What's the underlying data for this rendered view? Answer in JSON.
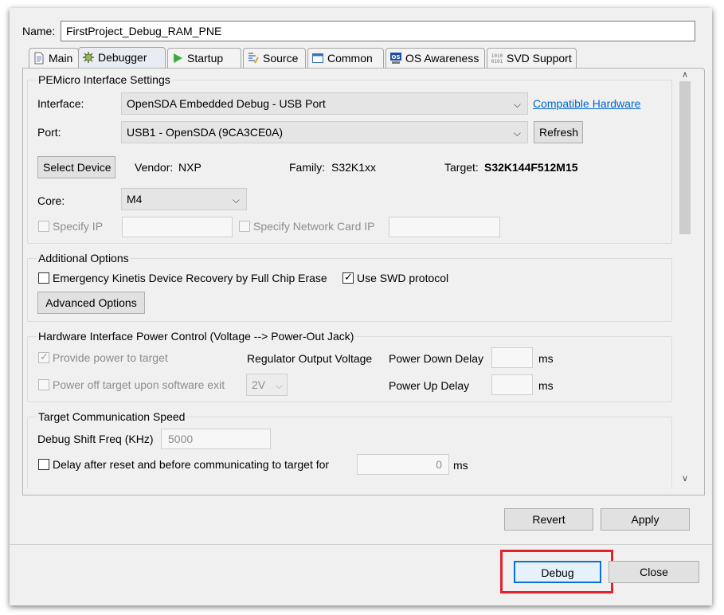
{
  "name": {
    "label": "Name:",
    "value": "FirstProject_Debug_RAM_PNE"
  },
  "tabs": [
    {
      "label": "Main",
      "icon": "document-icon"
    },
    {
      "label": "Debugger",
      "icon": "bug-gear-icon",
      "active": true
    },
    {
      "label": "Startup",
      "icon": "play-icon"
    },
    {
      "label": "Source",
      "icon": "source-icon"
    },
    {
      "label": "Common",
      "icon": "window-icon"
    },
    {
      "label": "OS Awareness",
      "icon": "os-icon"
    },
    {
      "label": "SVD Support",
      "icon": "binary-icon"
    }
  ],
  "pemicro": {
    "title": "PEMicro Interface Settings",
    "interface_label": "Interface:",
    "interface_value": "OpenSDA Embedded Debug - USB Port",
    "compatible_hardware": "Compatible Hardware",
    "port_label": "Port:",
    "port_value": "USB1 - OpenSDA (9CA3CE0A)",
    "refresh": "Refresh",
    "select_device": "Select Device",
    "vendor_label": "Vendor:",
    "vendor_value": "NXP",
    "family_label": "Family:",
    "family_value": "S32K1xx",
    "target_label": "Target:",
    "target_value": "S32K144F512M15",
    "core_label": "Core:",
    "core_value": "M4",
    "specify_ip": "Specify IP",
    "specify_network_card_ip": "Specify Network Card IP"
  },
  "additional": {
    "title": "Additional Options",
    "emergency_recovery": "Emergency Kinetis Device Recovery by Full Chip Erase",
    "use_swd": "Use SWD protocol",
    "advanced_options": "Advanced Options"
  },
  "power": {
    "title": "Hardware Interface Power Control (Voltage --> Power-Out Jack)",
    "provide_power": "Provide power to target",
    "power_off": "Power off target upon software exit",
    "regulator_label": "Regulator Output Voltage",
    "regulator_value": "2V",
    "power_down_label": "Power Down Delay",
    "power_down_unit": "ms",
    "power_up_label": "Power Up Delay",
    "power_up_unit": "ms"
  },
  "speed": {
    "title": "Target Communication Speed",
    "shift_freq_label": "Debug Shift Freq (KHz)",
    "shift_freq_value": "5000",
    "delay_label": "Delay after reset and before communicating to target for",
    "delay_value": "0",
    "delay_unit": "ms"
  },
  "buttons": {
    "revert": "Revert",
    "apply": "Apply",
    "debug": "Debug",
    "close": "Close"
  },
  "colors": {
    "highlight": "#e3222b",
    "link": "#0066cc",
    "default_button_border": "#0a6fd6"
  }
}
